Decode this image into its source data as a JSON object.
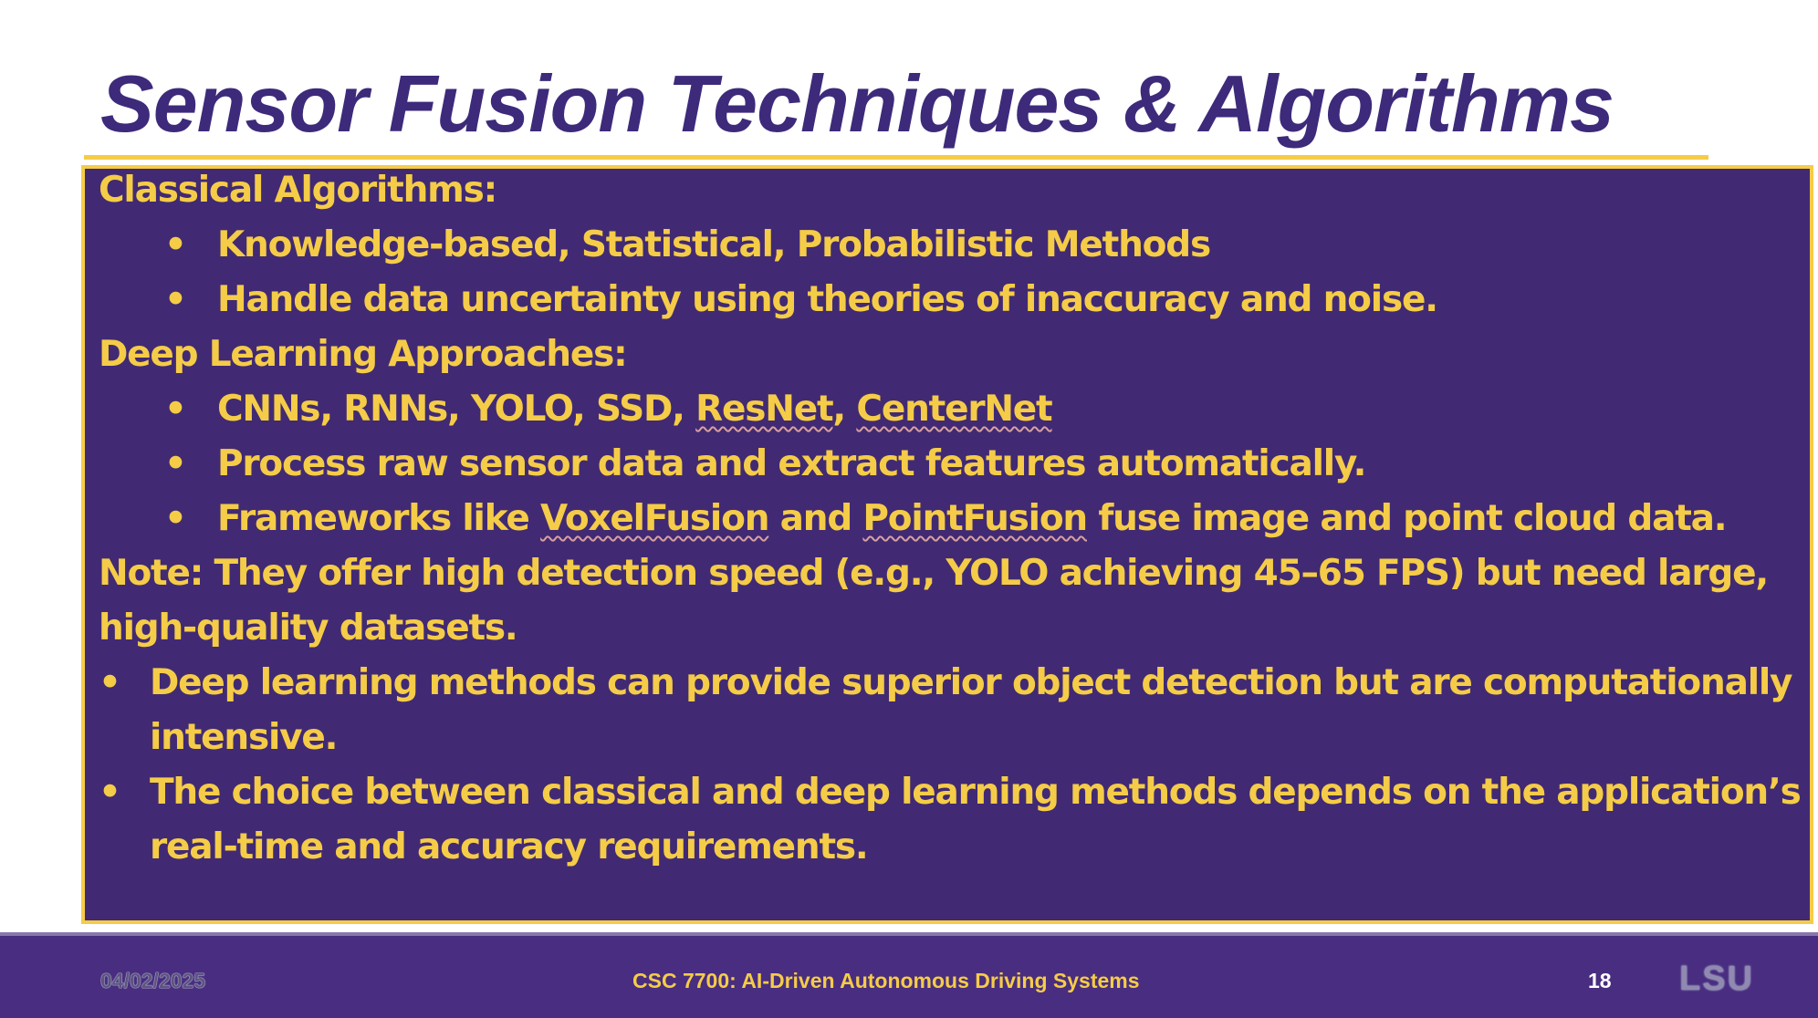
{
  "colors": {
    "purple": "#412a73",
    "title_purple": "#3d2a7a",
    "gold": "#f5cc47",
    "footer_purple": "#482d80",
    "white": "#ffffff"
  },
  "slide": {
    "title": "Sensor Fusion Techniques & Algorithms",
    "lines": [
      {
        "kind": "heading",
        "text": "Classical Algorithms:"
      },
      {
        "kind": "sub",
        "bullet": "•",
        "text": "Knowledge-based, Statistical, Probabilistic Methods"
      },
      {
        "kind": "sub",
        "bullet": "•",
        "text": "Handle data uncertainty using theories of inaccuracy and noise."
      },
      {
        "kind": "heading",
        "text": "Deep Learning Approaches:"
      },
      {
        "kind": "sub",
        "bullet": "•",
        "text": "CNNs, RNNs, YOLO, SSD, ResNet, CenterNet"
      },
      {
        "kind": "sub",
        "bullet": "•",
        "text": "Process raw sensor data and extract features automatically."
      },
      {
        "kind": "sub",
        "bullet": "•",
        "text": "Frameworks like VoxelFusion and PointFusion fuse image and point cloud data."
      },
      {
        "kind": "heading",
        "text": "Note: They offer high detection speed (e.g., YOLO achieving 45–65 FPS) but need large,"
      },
      {
        "kind": "heading",
        "text": "high-quality datasets."
      },
      {
        "kind": "top",
        "bullet": "•",
        "text": "Deep learning methods can provide superior object detection but are computationally"
      },
      {
        "kind": "cont",
        "text": "intensive."
      },
      {
        "kind": "top",
        "bullet": "•",
        "text": "The choice between classical and deep learning methods depends on the application’s"
      },
      {
        "kind": "cont",
        "text": "real-time and accuracy requirements."
      }
    ],
    "spellcheck_words": [
      "ResNet",
      "CenterNet",
      "VoxelFusion",
      "PointFusion"
    ]
  },
  "footer": {
    "date": "04/02/2025",
    "course": "CSC 7700: AI-Driven Autonomous Driving Systems",
    "page": "18",
    "logo": "LSU"
  }
}
